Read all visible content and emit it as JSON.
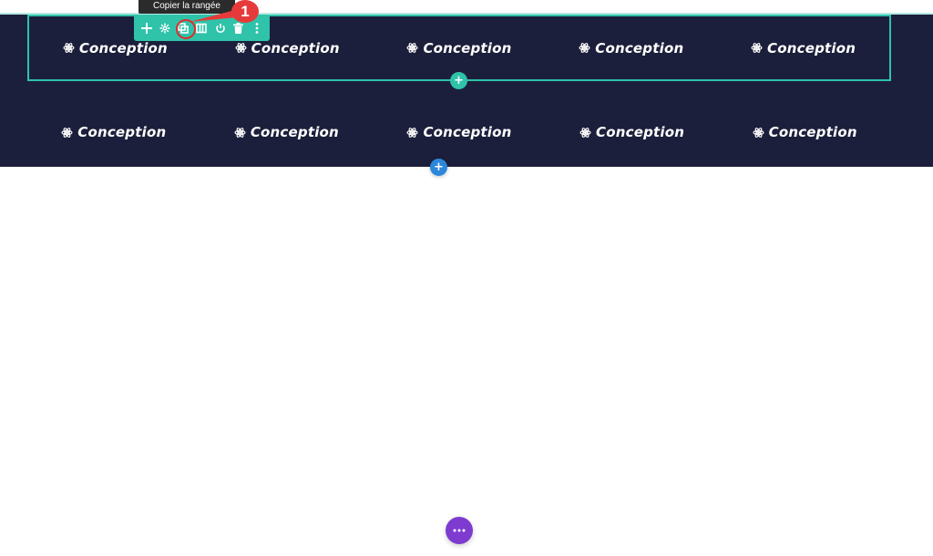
{
  "tooltip": {
    "text": "Copier la rangée"
  },
  "callout": {
    "number": "1"
  },
  "toolbar": {
    "icons": [
      "move-icon",
      "gear-icon",
      "copy-row-icon",
      "columns-icon",
      "power-icon",
      "trash-icon",
      "more-vertical-icon"
    ]
  },
  "rows": [
    {
      "columns": [
        {
          "icon": "atom-icon",
          "label": "Conception"
        },
        {
          "icon": "atom-icon",
          "label": "Conception"
        },
        {
          "icon": "atom-icon",
          "label": "Conception"
        },
        {
          "icon": "atom-icon",
          "label": "Conception"
        },
        {
          "icon": "atom-icon",
          "label": "Conception"
        }
      ]
    },
    {
      "columns": [
        {
          "icon": "atom-icon",
          "label": "Conception"
        },
        {
          "icon": "atom-icon",
          "label": "Conception"
        },
        {
          "icon": "atom-icon",
          "label": "Conception"
        },
        {
          "icon": "atom-icon",
          "label": "Conception"
        },
        {
          "icon": "atom-icon",
          "label": "Conception"
        }
      ]
    }
  ],
  "buttons": {
    "add_row": "+",
    "add_section": "+"
  },
  "colors": {
    "section_bg": "#1b1f3b",
    "row_accent": "#2fc3a9",
    "section_add": "#2b87da",
    "callout_red": "#e63a3a",
    "page_settings": "#7e3bd0"
  }
}
